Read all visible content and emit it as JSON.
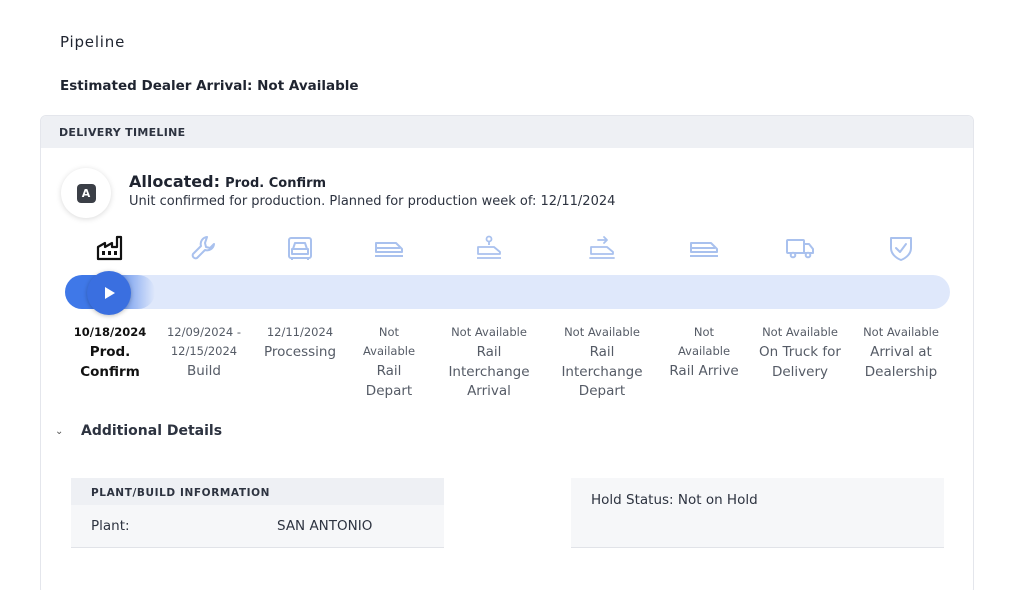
{
  "page": {
    "title": "Pipeline",
    "eta_label": "Estimated Dealer Arrival: Not Available"
  },
  "timeline": {
    "header": "DELIVERY TIMELINE",
    "badge_letter": "A",
    "status_main": "Allocated:",
    "status_sub": "Prod. Confirm",
    "description": "Unit confirmed for production. Planned for production week of: 12/11/2024",
    "progress_fraction": 0.0,
    "colors": {
      "accent": "#3a6fe0",
      "track": "#dfe8fb",
      "icon_muted": "#a9c1ee",
      "icon_active": "#111111"
    },
    "steps": [
      {
        "icon": "factory-icon",
        "date": "10/18/2024",
        "label": "Prod. Confirm",
        "active": true
      },
      {
        "icon": "wrench-icon",
        "date": "12/09/2024 - 12/15/2024",
        "label": "Build",
        "active": false
      },
      {
        "icon": "car-front-icon",
        "date": "12/11/2024",
        "label": "Processing",
        "active": false
      },
      {
        "icon": "railcar-icon",
        "date": "Not Available",
        "label": "Rail Depart",
        "active": false
      },
      {
        "icon": "rail-pin-icon",
        "date": "Not Available",
        "label": "Rail Interchange Arrival",
        "active": false
      },
      {
        "icon": "rail-arrow-icon",
        "date": "Not Available",
        "label": "Rail Interchange Depart",
        "active": false
      },
      {
        "icon": "railcar-icon",
        "date": "Not Available",
        "label": "Rail Arrive",
        "active": false
      },
      {
        "icon": "truck-icon",
        "date": "Not Available",
        "label": "On Truck for Delivery",
        "active": false
      },
      {
        "icon": "shield-check-icon",
        "date": "Not Available",
        "label": "Arrival at Dealership",
        "active": false
      }
    ]
  },
  "details": {
    "toggle_label": "Additional Details",
    "plant_header": "PLANT/BUILD INFORMATION",
    "plant_key": "Plant:",
    "plant_value": "SAN ANTONIO",
    "hold_status": "Hold Status: Not on Hold"
  }
}
